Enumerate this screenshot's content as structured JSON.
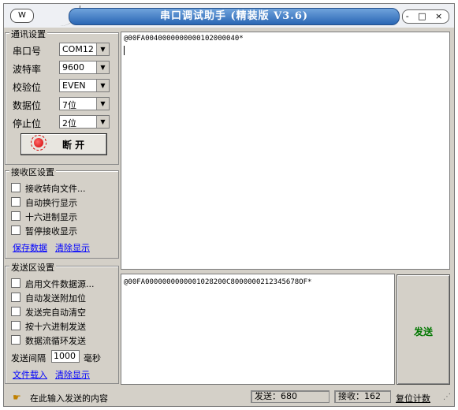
{
  "window": {
    "title": "串口调试助手  (精装版 V3.6)",
    "controls": "- □ ×",
    "menu_glyph": "W"
  },
  "comm": {
    "group_title": "通讯设置",
    "fields": [
      {
        "label": "串口号",
        "value": "COM12"
      },
      {
        "label": "波特率",
        "value": "9600"
      },
      {
        "label": "校验位",
        "value": "EVEN"
      },
      {
        "label": "数据位",
        "value": "7位"
      },
      {
        "label": "停止位",
        "value": "2位"
      }
    ],
    "connect_button": "断  开",
    "connect_state_color": "#d00000"
  },
  "receive": {
    "group_title": "接收区设置",
    "options": [
      "接收转向文件...",
      "自动换行显示",
      "十六进制显示",
      "暂停接收显示"
    ],
    "save_link": "保存数据",
    "clear_link": "清除显示",
    "content": "@00FA0040000000000102000040*"
  },
  "send": {
    "group_title": "发送区设置",
    "options": [
      "启用文件数据源...",
      "自动发送附加位",
      "发送完自动清空",
      "按十六进制发送",
      "数据流循环发送"
    ],
    "interval_label": "发送间隔",
    "interval_value": "1000",
    "interval_unit": "毫秒",
    "load_link": "文件载入",
    "clear_link": "清除显示",
    "content": "@00FA0000000000001028200C8000000212345678OF*",
    "button": "发送",
    "button_color": "#007700"
  },
  "status": {
    "hint": "在此输入发送的内容",
    "sent": "发送：680",
    "received": "接收：162",
    "reset": "复位计数"
  }
}
